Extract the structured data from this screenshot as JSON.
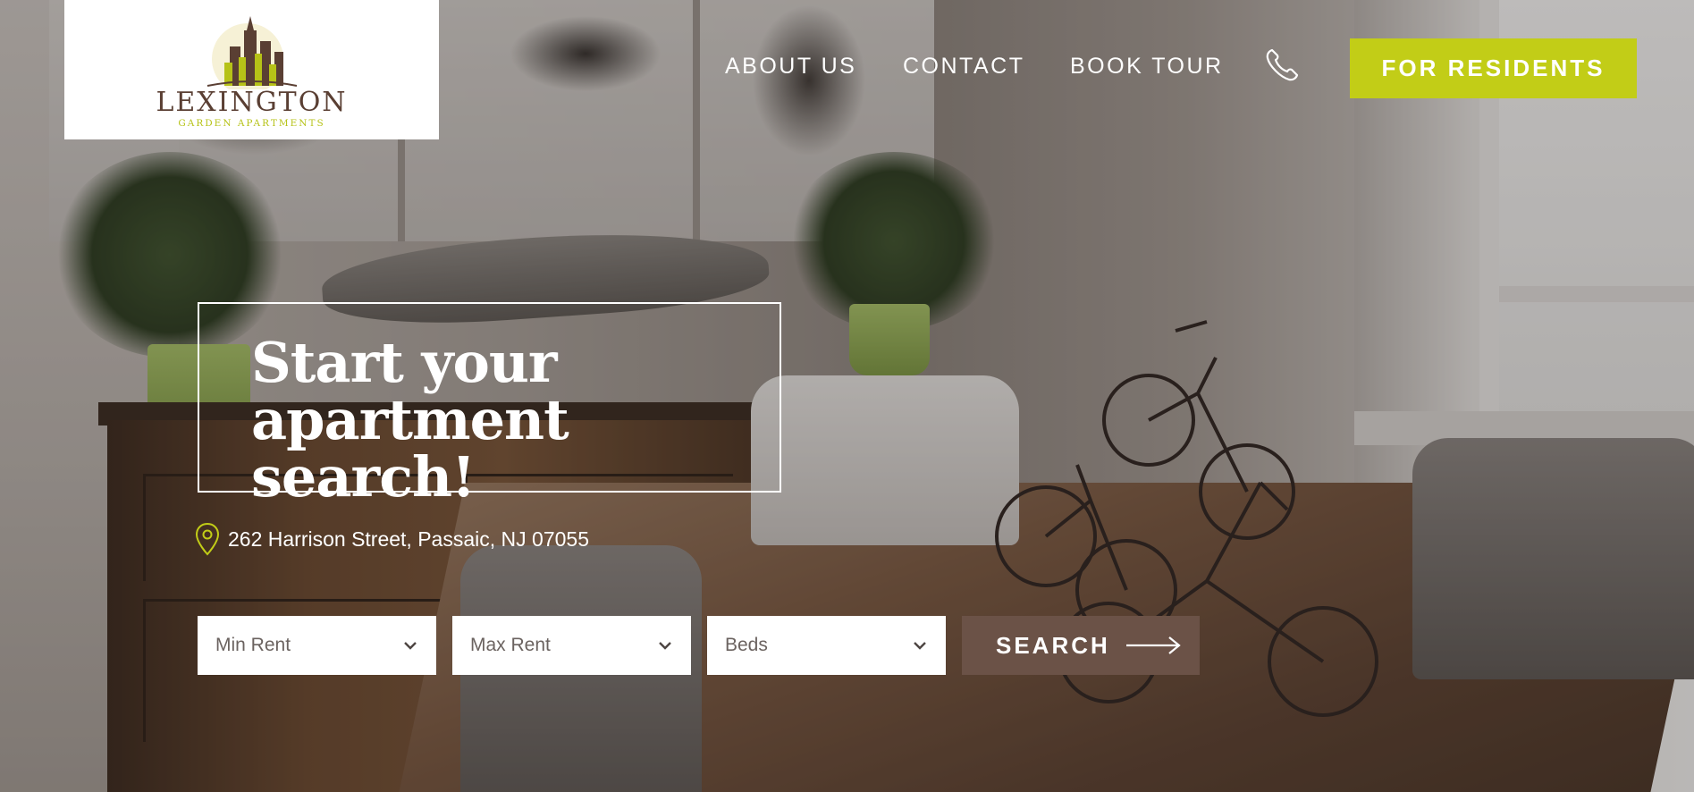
{
  "brand": {
    "name": "LEXINGTON",
    "tagline": "GARDEN APARTMENTS",
    "colors": {
      "accent": "#c2cd17",
      "brown": "#5a3f33",
      "search_button": "#6b5247"
    }
  },
  "nav": {
    "items": [
      {
        "label": "ABOUT US"
      },
      {
        "label": "CONTACT"
      },
      {
        "label": "BOOK TOUR"
      }
    ],
    "phone_icon": "phone-icon",
    "cta_label": "FOR RESIDENTS"
  },
  "hero": {
    "headline_line1": "Start your",
    "headline_line2": "apartment search!",
    "address": "262 Harrison Street, Passaic, NJ 07055",
    "address_icon": "map-pin-icon"
  },
  "search": {
    "min_rent": {
      "placeholder": "Min Rent"
    },
    "max_rent": {
      "placeholder": "Max Rent"
    },
    "beds": {
      "placeholder": "Beds"
    },
    "button_label": "SEARCH",
    "button_icon": "arrow-right-icon"
  }
}
